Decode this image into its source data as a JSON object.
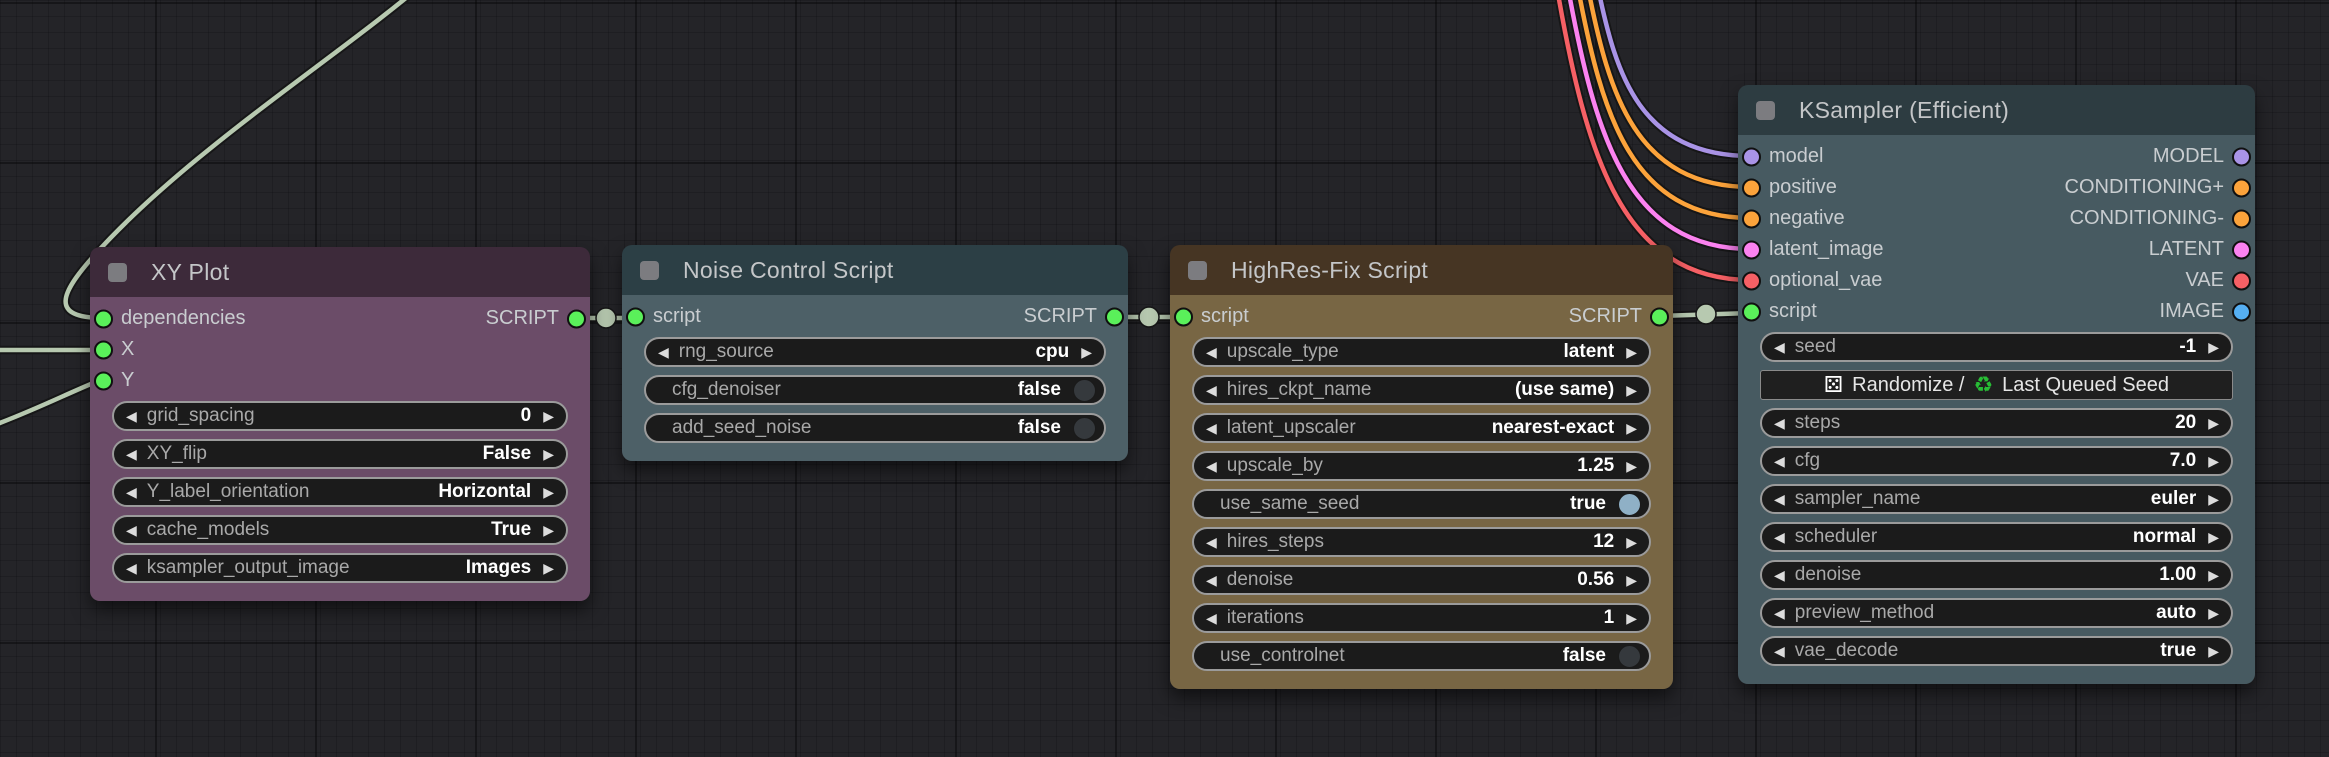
{
  "icons": {
    "left_arrow": "◀",
    "right_arrow": "▶",
    "dice": "⚄",
    "recycle": "♻"
  },
  "theme": {
    "toggle_on": "#8fb0c6",
    "toggle_off": "#35393d",
    "link_colors": {
      "script": "#b7c9b0",
      "model": "#a993e6",
      "conditioning": "#fca33b",
      "latent": "#fb82f0",
      "vae": "#f66065"
    }
  },
  "nodes": {
    "xy_plot": {
      "title": "XY Plot",
      "header_color": "#3d2a3a",
      "body_color": "#6b4c68",
      "rows": [
        {
          "in": "dependencies",
          "in_color": "#5af05a",
          "out": "SCRIPT",
          "out_color": "#5af05a"
        },
        {
          "in": "X",
          "in_color": "#5af05a"
        },
        {
          "in": "Y",
          "in_color": "#5af05a"
        }
      ],
      "widgets": [
        {
          "label": "grid_spacing",
          "value": "0"
        },
        {
          "label": "XY_flip",
          "value": "False"
        },
        {
          "label": "Y_label_orientation",
          "value": "Horizontal"
        },
        {
          "label": "cache_models",
          "value": "True"
        },
        {
          "label": "ksampler_output_image",
          "value": "Images"
        }
      ]
    },
    "noise_control": {
      "title": "Noise Control Script",
      "header_color": "#2c3f45",
      "body_color": "#4d6067",
      "rows": [
        {
          "in": "script",
          "in_color": "#5af05a",
          "out": "SCRIPT",
          "out_color": "#5af05a"
        }
      ],
      "widgets": [
        {
          "label": "rng_source",
          "value": "cpu"
        },
        {
          "label": "cfg_denoiser",
          "value": "false"
        },
        {
          "label": "add_seed_noise",
          "value": "false"
        }
      ]
    },
    "hires_fix": {
      "title": "HighRes-Fix Script",
      "header_color": "#463523",
      "body_color": "#786644",
      "rows": [
        {
          "in": "script",
          "in_color": "#5af05a",
          "out": "SCRIPT",
          "out_color": "#5af05a"
        }
      ],
      "widgets": [
        {
          "label": "upscale_type",
          "value": "latent"
        },
        {
          "label": "hires_ckpt_name",
          "value": "(use same)"
        },
        {
          "label": "latent_upscaler",
          "value": "nearest-exact"
        },
        {
          "label": "upscale_by",
          "value": "1.25"
        },
        {
          "label": "use_same_seed",
          "value": "true"
        },
        {
          "label": "hires_steps",
          "value": "12"
        },
        {
          "label": "denoise",
          "value": "0.56"
        },
        {
          "label": "iterations",
          "value": "1"
        },
        {
          "label": "use_controlnet",
          "value": "false"
        }
      ]
    },
    "ksampler": {
      "title": "KSampler (Efficient)",
      "header_color": "#2d3c41",
      "body_color": "#475a61",
      "rows": [
        {
          "in": "model",
          "in_color": "#a993e6",
          "out": "MODEL",
          "out_color": "#a993e6"
        },
        {
          "in": "positive",
          "in_color": "#fca33b",
          "out": "CONDITIONING+",
          "out_color": "#fca33b"
        },
        {
          "in": "negative",
          "in_color": "#fca33b",
          "out": "CONDITIONING-",
          "out_color": "#fca33b"
        },
        {
          "in": "latent_image",
          "in_color": "#fb82f0",
          "out": "LATENT",
          "out_color": "#fb82f0"
        },
        {
          "in": "optional_vae",
          "in_color": "#f66065",
          "out": "VAE",
          "out_color": "#f66065"
        },
        {
          "in": "script",
          "in_color": "#5af05a",
          "out": "IMAGE",
          "out_color": "#55aff2"
        }
      ],
      "seed_button": {
        "text_1": "Randomize /",
        "text_2": "Last Queued Seed"
      },
      "widgets": [
        {
          "label": "seed",
          "value": "-1"
        },
        {
          "label": "steps",
          "value": "20"
        },
        {
          "label": "cfg",
          "value": "7.0"
        },
        {
          "label": "sampler_name",
          "value": "euler"
        },
        {
          "label": "scheduler",
          "value": "normal"
        },
        {
          "label": "denoise",
          "value": "1.00"
        },
        {
          "label": "preview_method",
          "value": "auto"
        },
        {
          "label": "vae_decode",
          "value": "true"
        }
      ]
    }
  }
}
